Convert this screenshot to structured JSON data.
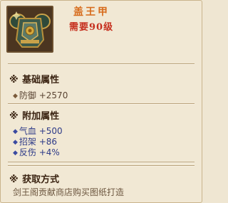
{
  "item": {
    "name": "盖王甲",
    "requirement": "需要90级",
    "icon": "armor-icon"
  },
  "sections": {
    "base": {
      "title": "基础属性",
      "mark": "※",
      "stats": [
        {
          "label": "防御 +2570"
        }
      ]
    },
    "extra": {
      "title": "附加属性",
      "mark": "※",
      "stats": [
        {
          "label": "气血 +500"
        },
        {
          "label": "招架 +86"
        },
        {
          "label": "反伤 +4%"
        }
      ]
    },
    "source": {
      "title": "获取方式",
      "mark": "※",
      "description": "剑王阁贡献商店购买图纸打造"
    }
  },
  "colors": {
    "name": "#d76a1a",
    "requirement": "#c62f1e",
    "stat_blue": "#2d3a88",
    "heading": "#3b2412"
  }
}
